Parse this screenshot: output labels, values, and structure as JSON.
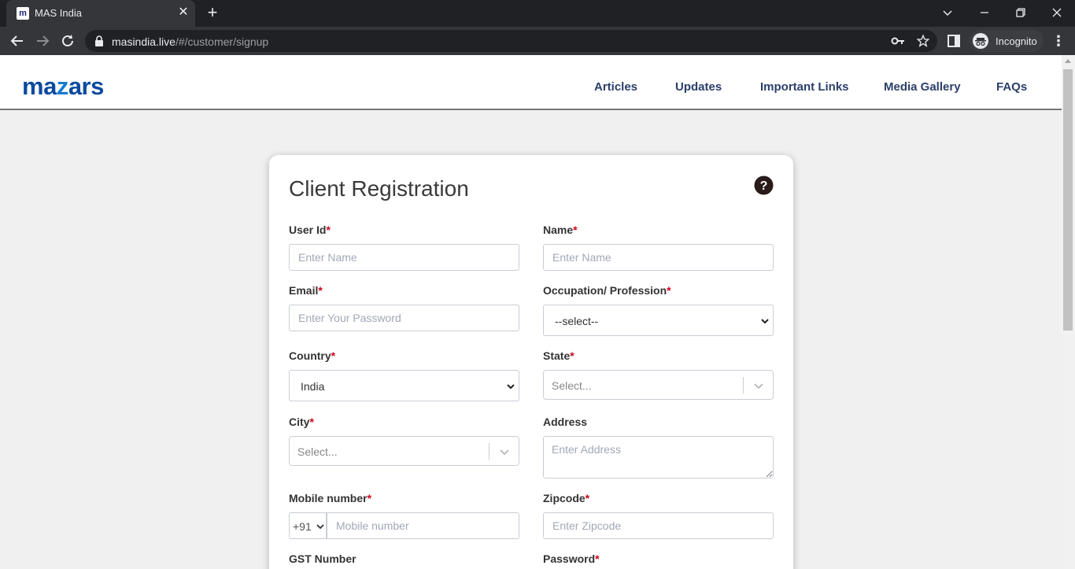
{
  "browser": {
    "tab_title": "MAS India",
    "favicon_letter": "m",
    "url_host": "masindia.live",
    "url_path": "/#/customer/signup",
    "incognito_label": "Incognito"
  },
  "site": {
    "logo_text_before": "ma",
    "logo_text_z": "z",
    "logo_text_after": "ars",
    "nav": [
      "Articles",
      "Updates",
      "Important Links",
      "Media Gallery",
      "FAQs"
    ]
  },
  "form": {
    "title": "Client Registration",
    "required_marker": "*",
    "user_id": {
      "label": "User Id",
      "placeholder": "Enter Name"
    },
    "name": {
      "label": "Name",
      "placeholder": "Enter Name"
    },
    "email": {
      "label": "Email",
      "placeholder": "Enter Your Password"
    },
    "occupation": {
      "label": "Occupation/ Profession",
      "value": "--select--"
    },
    "country": {
      "label": "Country",
      "value": "India"
    },
    "state": {
      "label": "State",
      "placeholder": "Select..."
    },
    "city": {
      "label": "City",
      "placeholder": "Select..."
    },
    "address": {
      "label": "Address",
      "placeholder": "Enter Address"
    },
    "mobile": {
      "label": "Mobile number",
      "code": "+91",
      "placeholder": "Mobile number"
    },
    "zipcode": {
      "label": "Zipcode",
      "placeholder": "Enter Zipcode"
    },
    "gst": {
      "label": "GST Number"
    },
    "password": {
      "label": "Password"
    }
  }
}
